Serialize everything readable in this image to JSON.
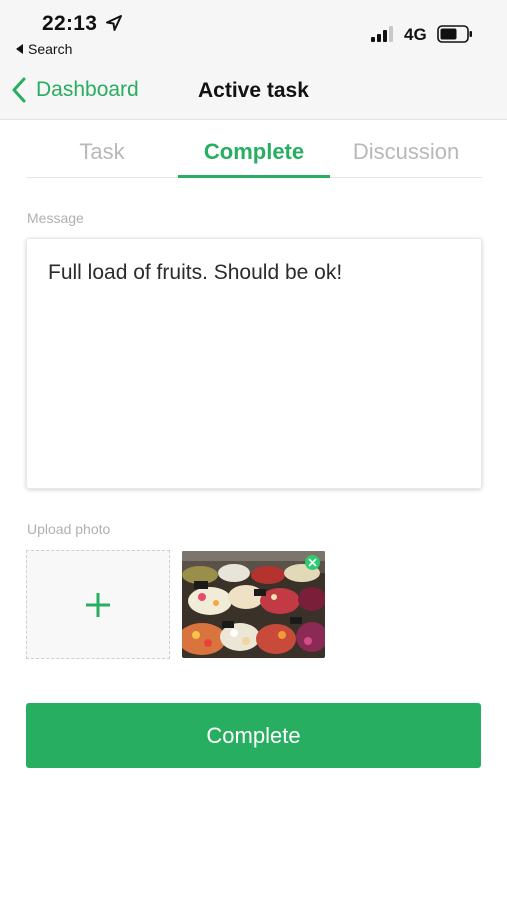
{
  "status_bar": {
    "time": "22:13",
    "back_app": "Search",
    "network": "4G",
    "icons": [
      "location-arrow-icon",
      "signal-bars-icon",
      "battery-icon"
    ]
  },
  "nav": {
    "back_label": "Dashboard",
    "title": "Active task"
  },
  "tabs": [
    {
      "label": "Task",
      "active": false
    },
    {
      "label": "Complete",
      "active": true
    },
    {
      "label": "Discussion",
      "active": false
    }
  ],
  "message": {
    "label": "Message",
    "value": "Full load of fruits. Should be ok!"
  },
  "upload": {
    "label": "Upload photo",
    "add_icon": "plus-icon",
    "photos": [
      {
        "subject": "fruit-market-stall"
      }
    ]
  },
  "complete_button": {
    "label": "Complete"
  },
  "colors": {
    "accent": "#27ae60",
    "bar_bg": "#f6f6f6",
    "muted_text": "#b0b0b0"
  }
}
